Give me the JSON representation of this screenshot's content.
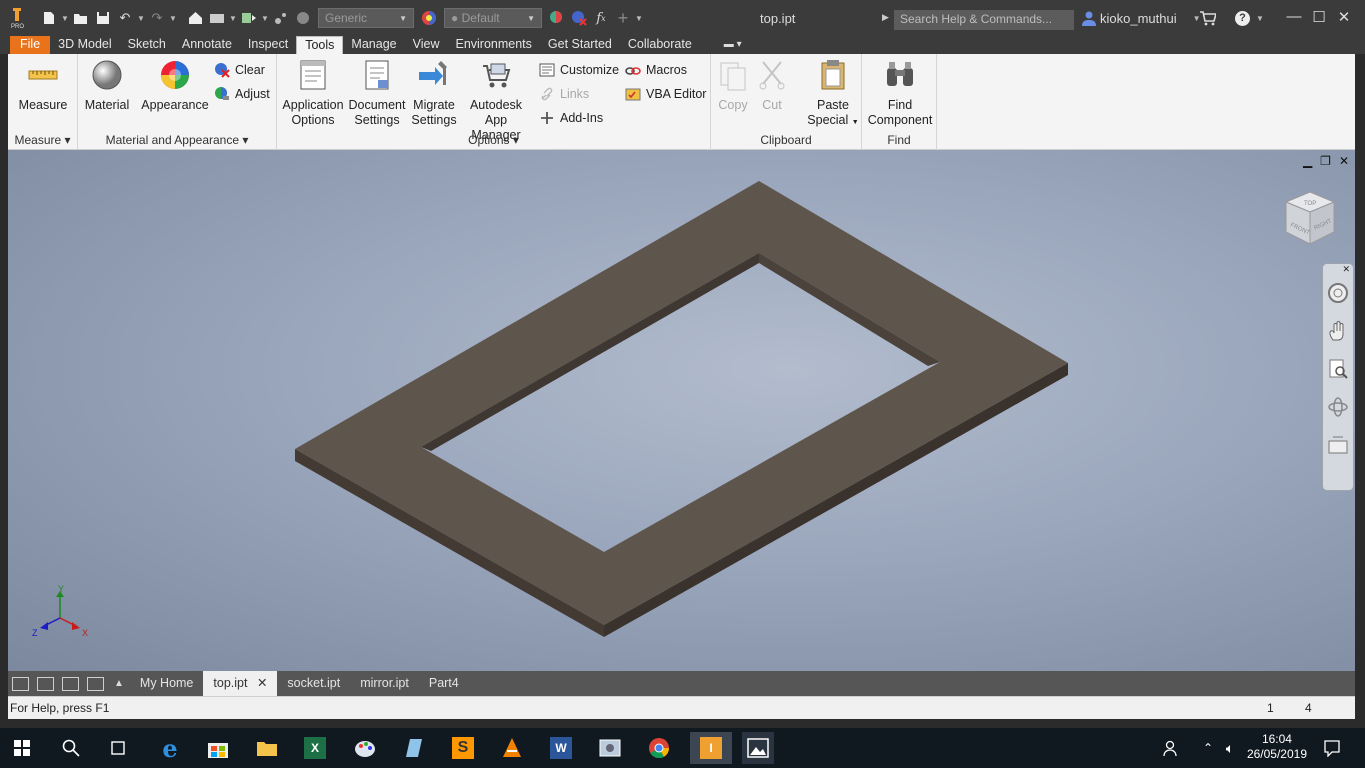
{
  "window": {
    "title": "top.ipt",
    "search_placeholder": "Search Help & Commands...",
    "user": "kioko_muthui",
    "material_combo": "Generic",
    "appearance_combo": "Default"
  },
  "tabs": [
    "File",
    "3D Model",
    "Sketch",
    "Annotate",
    "Inspect",
    "Tools",
    "Manage",
    "View",
    "Environments",
    "Get Started",
    "Collaborate"
  ],
  "ribbon": {
    "measure": {
      "label": "Measure",
      "panel": "Measure"
    },
    "material": {
      "label": "Material"
    },
    "appearance": {
      "label": "Appearance"
    },
    "clear": "Clear",
    "adjust": "Adjust",
    "mat_panel": "Material and Appearance",
    "app_options": [
      "Application",
      "Options"
    ],
    "doc_settings": [
      "Document",
      "Settings"
    ],
    "migrate": [
      "Migrate",
      "Settings"
    ],
    "app_manager": [
      "Autodesk",
      "App Manager"
    ],
    "customize": "Customize",
    "links": "Links",
    "addins": "Add-Ins",
    "macros": "Macros",
    "vba": "VBA Editor",
    "options_panel": "Options",
    "copy": "Copy",
    "cut": "Cut",
    "paste": [
      "Paste",
      "Special"
    ],
    "clipboard_panel": "Clipboard",
    "find": [
      "Find",
      "Component"
    ],
    "find_panel": "Find"
  },
  "viewcube": {
    "top": "TOP",
    "front": "FRONT",
    "right": "RIGHT"
  },
  "axes": {
    "x": "X",
    "y": "Y",
    "z": "Z"
  },
  "doc_tabs": [
    "My Home",
    "top.ipt",
    "socket.ipt",
    "mirror.ipt",
    "Part4"
  ],
  "active_doc": "top.ipt",
  "status": {
    "help": "For Help, press F1",
    "count1": "1",
    "count2": "4"
  },
  "clock": {
    "time": "16:04",
    "date": "26/05/2019"
  }
}
